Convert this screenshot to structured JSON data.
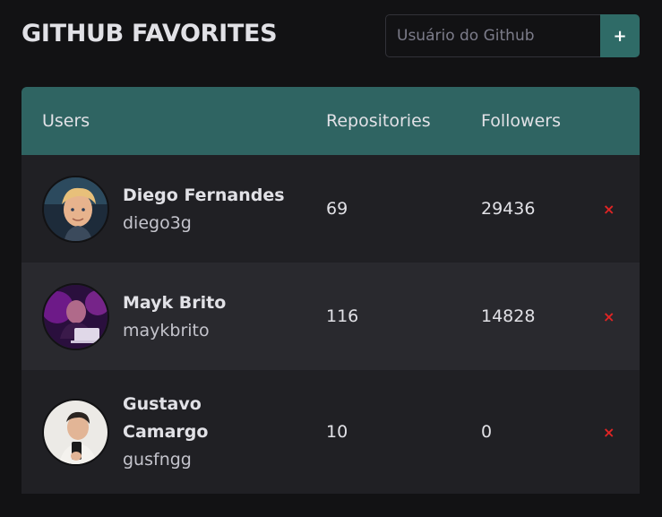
{
  "header": {
    "title": "GITHUB FAVORITES",
    "search_placeholder": "Usuário do Github",
    "add_label": "+"
  },
  "table": {
    "columns": [
      "Users",
      "Repositories",
      "Followers"
    ],
    "rows": [
      {
        "name": "Diego Fernandes",
        "login": "diego3g",
        "repositories": "69",
        "followers": "29436",
        "remove_label": "×"
      },
      {
        "name": "Mayk Brito",
        "login": "maykbrito",
        "repositories": "116",
        "followers": "14828",
        "remove_label": "×"
      },
      {
        "name": "Gustavo Camargo",
        "login": "gusfngg",
        "repositories": "10",
        "followers": "0",
        "remove_label": "×"
      }
    ]
  },
  "colors": {
    "background": "#121214",
    "header_row": "#2f6462",
    "accent": "#2f6b67",
    "remove": "#e02424"
  }
}
